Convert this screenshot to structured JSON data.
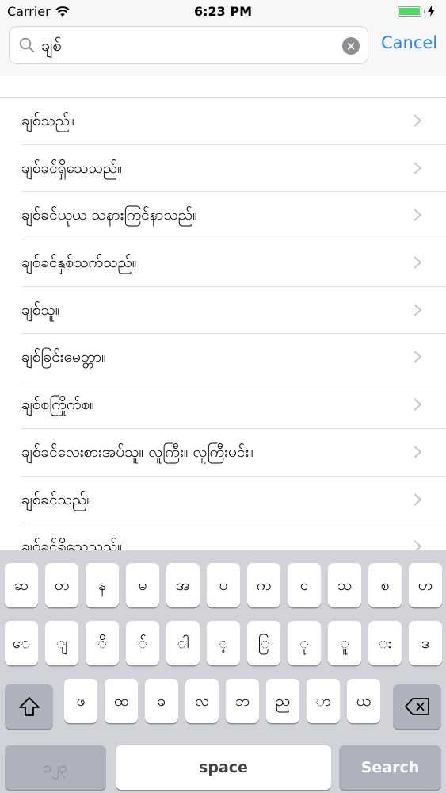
{
  "status": {
    "carrier": "Carrier",
    "time": "6:23 PM"
  },
  "search": {
    "query": "ချစ်",
    "cancel_label": "Cancel"
  },
  "results": [
    "ချစ်သည်။",
    "ချစ်ခင်ရှိသေသည်။",
    "ချစ်ခင်ယုယ သနားကြင်နာသည်။",
    "ချစ်ခင်နှစ်သက်သည်။",
    "ချစ်သူ။",
    "ချစ်ခြင်းမေတ္တာ။",
    "ချစ်စကြိုက်စ။",
    "ချစ်ခင်လေးစားအပ်သူ။ လူကြီး။ လူကြီးမင်း။",
    "ချစ်ခင်သည်။",
    "ချစ်ခင်ရှိသေသည်။"
  ],
  "keyboard": {
    "row1": [
      "ဆ",
      "တ",
      "န",
      "မ",
      "အ",
      "ပ",
      "က",
      "င",
      "သ",
      "စ",
      "ဟ"
    ],
    "row2": [
      "ေ",
      "ျ",
      "ိ",
      "်",
      "ါ",
      "့",
      "ြ",
      "ု",
      "ူ",
      "း",
      "ဒ"
    ],
    "row3": [
      "ဖ",
      "ထ",
      "ခ",
      "လ",
      "ဘ",
      "ည",
      "ာ",
      "ယ"
    ],
    "numbers_label": "၁၂၃",
    "space_label": "space",
    "search_label": "Search"
  }
}
